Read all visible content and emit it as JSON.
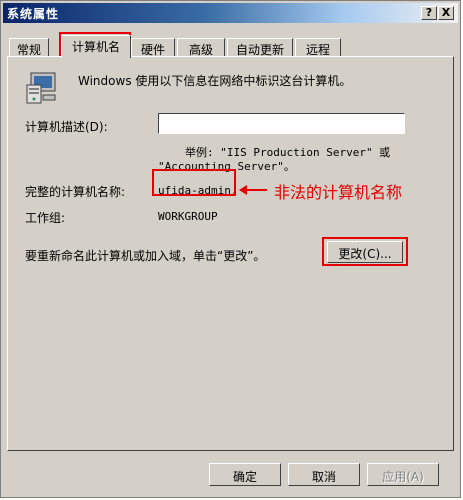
{
  "window": {
    "title": "系统属性",
    "help_btn": "?",
    "close_btn": "X"
  },
  "tabs": [
    {
      "label": "常规"
    },
    {
      "label": "计算机名"
    },
    {
      "label": "硬件"
    },
    {
      "label": "高级"
    },
    {
      "label": "自动更新"
    },
    {
      "label": "远程"
    }
  ],
  "panel": {
    "intro": "Windows 使用以下信息在网络中标识这台计算机。",
    "desc_label": "计算机描述(D):",
    "desc_value": "",
    "example_line1": "举例: \"IIS Production Server\" 或",
    "example_line2": "\"Accounting Server\"。",
    "full_name_label": "完整的计算机名称:",
    "full_name_value": "ufida-admin.",
    "workgroup_label": "工作组:",
    "workgroup_value": "WORKGROUP",
    "rename_text": "要重新命名此计算机或加入域，单击“更改”。",
    "change_btn": "更改(C)..."
  },
  "annotation": {
    "text": "非法的计算机名称",
    "color": "#e60000"
  },
  "footer": {
    "ok_btn": "确定",
    "cancel_btn": "取消",
    "apply_btn": "应用(A)"
  },
  "colors": {
    "accent": "#e60000",
    "face": "#d4d0c8",
    "title_start": "#0a246a"
  }
}
